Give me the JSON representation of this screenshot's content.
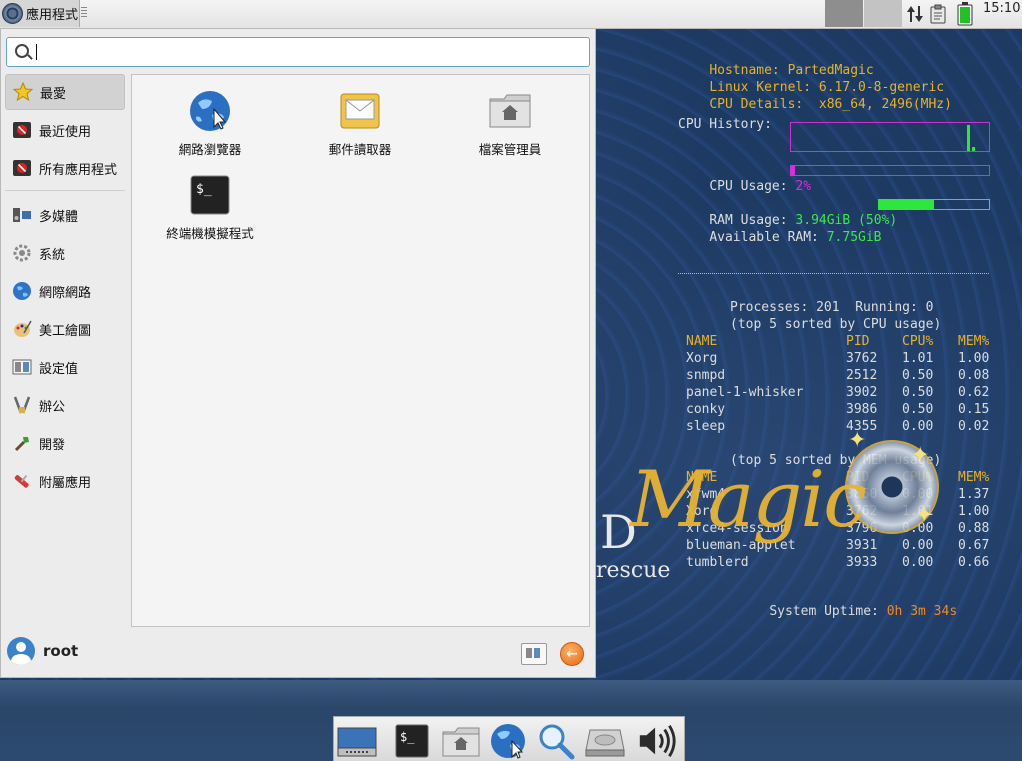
{
  "top_panel": {
    "apps_label": "應用程式",
    "clock": "15:10"
  },
  "menu": {
    "search": {
      "value": "",
      "placeholder": ""
    },
    "categories": [
      {
        "label": "最愛",
        "icon": "star-icon"
      },
      {
        "label": "最近使用",
        "icon": "recent-icon"
      },
      {
        "label": "所有應用程式",
        "icon": "all-apps-icon"
      },
      {
        "label": "多媒體",
        "icon": "multimedia-icon"
      },
      {
        "label": "系統",
        "icon": "system-gear-icon"
      },
      {
        "label": "網際網路",
        "icon": "internet-globe-icon"
      },
      {
        "label": "美工繪圖",
        "icon": "graphics-palette-icon"
      },
      {
        "label": "設定值",
        "icon": "settings-icon"
      },
      {
        "label": "辦公",
        "icon": "office-icon"
      },
      {
        "label": "開發",
        "icon": "development-icon"
      },
      {
        "label": "附屬應用",
        "icon": "accessories-icon"
      }
    ],
    "apps": [
      {
        "label": "網路瀏覽器",
        "icon": "web-browser-icon"
      },
      {
        "label": "郵件讀取器",
        "icon": "mail-reader-icon"
      },
      {
        "label": "檔案管理員",
        "icon": "file-manager-icon"
      },
      {
        "label": "終端機模擬程式",
        "icon": "terminal-icon"
      }
    ],
    "username": "root"
  },
  "conky": {
    "hostname_label": "Hostname:",
    "hostname": "PartedMagic",
    "kernel_label": "Linux Kernel:",
    "kernel": "6.17.0-8-generic",
    "cpu_details_label": "CPU Details:",
    "cpu_details": "x86_64, 2496(MHz)",
    "cpu_history_label": "CPU History:",
    "cpu_usage_label": "CPU Usage:",
    "cpu_usage": "2%",
    "cpu_usage_fraction": 0.02,
    "ram_usage_label": "RAM Usage:",
    "ram_usage": "3.94GiB (50%)",
    "ram_usage_fraction": 0.5,
    "available_ram_label": "Available RAM:",
    "available_ram": "7.75GiB",
    "processes_line": "Processes: 201  Running: 0",
    "cpu_sort_line": "(top 5 sorted by CPU usage)",
    "mem_sort_line": "(top 5 sorted by MEM usage)",
    "col_name": "NAME",
    "col_pid": "PID",
    "col_cpu": "CPU%",
    "col_mem": "MEM%",
    "top_cpu": [
      {
        "name": "Xorg",
        "pid": "3762",
        "cpu": "1.01",
        "mem": "1.00"
      },
      {
        "name": "snmpd",
        "pid": "2512",
        "cpu": "0.50",
        "mem": "0.08"
      },
      {
        "name": "panel-1-whisker",
        "pid": "3902",
        "cpu": "0.50",
        "mem": "0.62"
      },
      {
        "name": "conky",
        "pid": "3986",
        "cpu": "0.50",
        "mem": "0.15"
      },
      {
        "name": "sleep",
        "pid": "4355",
        "cpu": "0.00",
        "mem": "0.02"
      }
    ],
    "top_mem": [
      {
        "name": "xfwm4",
        "pid": "3860",
        "cpu": "0.00",
        "mem": "1.37"
      },
      {
        "name": "Xorg",
        "pid": "3762",
        "cpu": "1.01",
        "mem": "1.00"
      },
      {
        "name": "xfce4-session",
        "pid": "3796",
        "cpu": "0.00",
        "mem": "0.88"
      },
      {
        "name": "blueman-applet",
        "pid": "3931",
        "cpu": "0.00",
        "mem": "0.67"
      },
      {
        "name": "tumblerd",
        "pid": "3933",
        "cpu": "0.00",
        "mem": "0.66"
      }
    ],
    "uptime_label": "System Uptime:",
    "uptime": "0h 3m 34s"
  },
  "logo": {
    "d": "D",
    "magic": "Magic",
    "rescue": "rescue"
  },
  "dock": {
    "items": [
      {
        "icon": "show-desktop-icon"
      },
      {
        "icon": "terminal-icon"
      },
      {
        "icon": "home-folder-icon"
      },
      {
        "icon": "web-browser-icon"
      },
      {
        "icon": "app-finder-icon"
      },
      {
        "icon": "disk-drive-icon"
      },
      {
        "icon": "volume-icon"
      }
    ]
  }
}
